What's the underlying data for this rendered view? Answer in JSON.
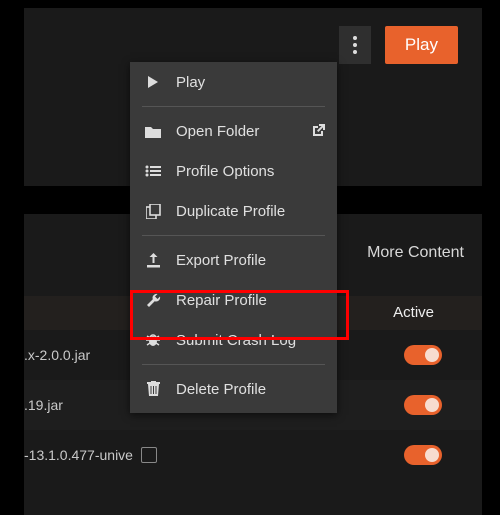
{
  "topbar": {
    "play_label": "Play"
  },
  "tabs": {
    "more_content": "More Content"
  },
  "columns": {
    "active": "Active"
  },
  "files": [
    {
      "name": ".x-2.0.0.jar",
      "active": true
    },
    {
      "name": ".19.jar",
      "active": true
    },
    {
      "name": "-13.1.0.477-unive",
      "active": true
    }
  ],
  "menu": {
    "play": "Play",
    "open": "Open Folder",
    "options": "Profile Options",
    "duplicate": "Duplicate Profile",
    "export": "Export Profile",
    "repair": "Repair Profile",
    "crash": "Submit Crash Log",
    "delete": "Delete Profile"
  }
}
